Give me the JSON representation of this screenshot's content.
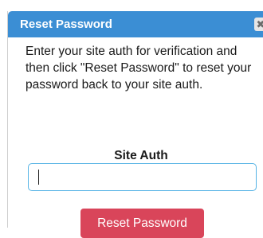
{
  "dialog": {
    "title": "Reset Password",
    "close_glyph": "✖",
    "instructions": "Enter your site auth for verification and then click \"Reset Password\" to reset your password back to your site auth.",
    "field_label": "Site Auth",
    "input_value": "",
    "submit_label": "Reset Password"
  },
  "colors": {
    "titlebar": "#3b8ed4",
    "input_border": "#55b3e5",
    "submit_button": "#d9455a"
  }
}
